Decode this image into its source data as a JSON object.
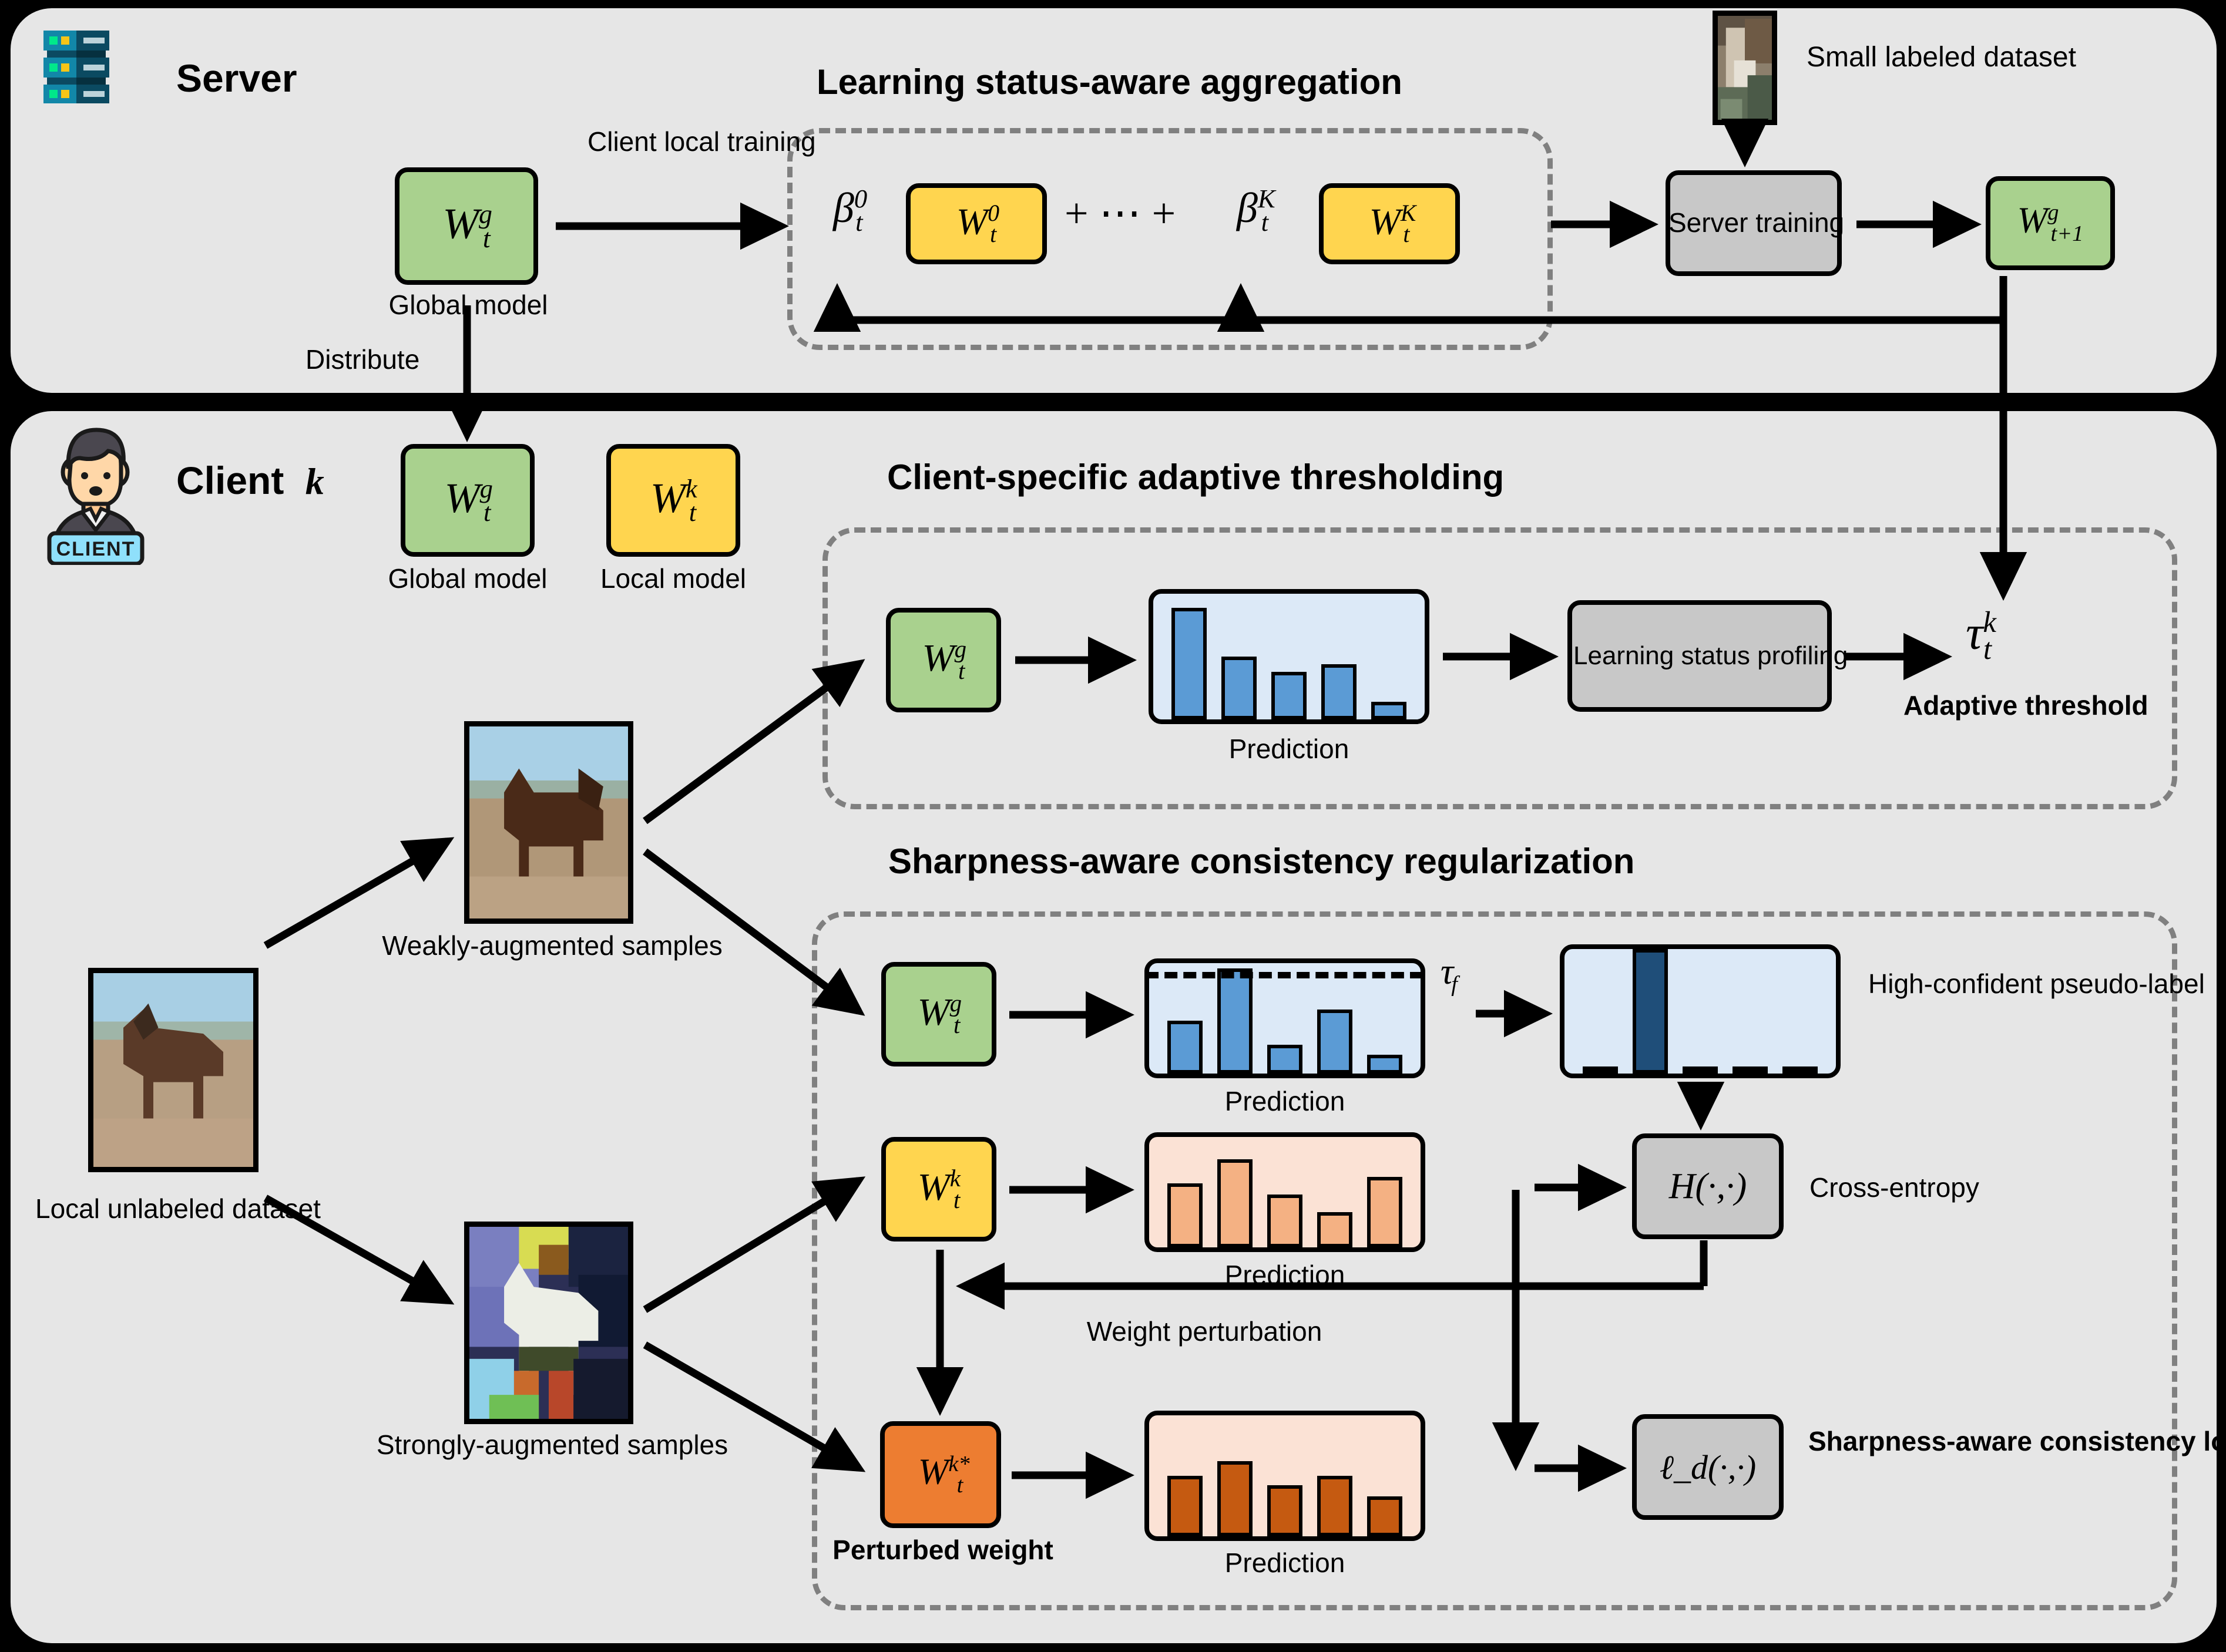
{
  "server": {
    "label": "Server",
    "icon": "server-rack-icon",
    "section_title": "Learning status-aware aggregation",
    "global_model_box": "W_t^g",
    "global_model_caption": "Global model",
    "arrow_label_client_local_training": "Client local training",
    "aggregation": {
      "beta_first": "β_t^0",
      "w_first": "W_t^0",
      "ellipsis": "+ ⋯ +",
      "beta_last": "β_t^K",
      "w_last": "W_t^K"
    },
    "small_labeled_dataset_label": "Small labeled dataset",
    "server_training_label": "Server training",
    "next_global_model": "W_{t+1}^g",
    "distribute_label": "Distribute"
  },
  "client": {
    "label": "Client",
    "index": "k",
    "icon": "client-person-icon",
    "icon_badge": "CLIENT",
    "global_model_box": "W_t^g",
    "global_model_caption": "Global model",
    "local_model_box": "W_t^k",
    "local_model_caption": "Local model",
    "local_dataset_caption": "Local unlabeled dataset",
    "weak_aug_caption": "Weakly-augmented samples",
    "strong_aug_caption": "Strongly-augmented samples"
  },
  "thresholding": {
    "section_title": "Client-specific adaptive thresholding",
    "model_box": "W_t^g",
    "prediction_caption": "Prediction",
    "profiling_label": "Learning status profiling",
    "tau_symbol": "τ_t^k",
    "tau_caption": "Adaptive threshold"
  },
  "sharpness": {
    "section_title": "Sharpness-aware consistency regularization",
    "global_box": "W_t^g",
    "local_box": "W_t^k",
    "perturbed_box": "W_t^{k*}",
    "perturbed_caption": "Perturbed weight",
    "prediction_caption": "Prediction",
    "tau_f": "τ_f",
    "pseudo_label_caption": "High-confident pseudo-label",
    "cross_entropy_symbol": "H(·,·)",
    "cross_entropy_caption": "Cross-entropy",
    "weight_perturbation_label": "Weight perturbation",
    "loss_symbol": "ℓ_d(·,·)",
    "loss_caption": "Sharpness-aware consistency loss"
  },
  "colors": {
    "panel_bg": "#e6e6e6",
    "green": "#a9d18e",
    "yellow": "#ffd54f",
    "orange": "#ed7d31",
    "grey_box": "#c8c8c8",
    "chart_blue_bg": "#dce9f7",
    "chart_peach_bg": "#fbe2d5",
    "bar_blue": "#5b9bd5",
    "bar_navy": "#1f4e79",
    "bar_light_orange": "#f4b183",
    "bar_dark_orange": "#c55a11",
    "dashed_border": "#808080",
    "outline": "#000000"
  },
  "chart_data": [
    {
      "id": "thresholding-prediction",
      "type": "bar",
      "title": "Prediction",
      "categories": [
        "1",
        "2",
        "3",
        "4",
        "5"
      ],
      "values": [
        0.9,
        0.5,
        0.38,
        0.44,
        0.14
      ],
      "ylim": [
        0,
        1
      ],
      "series_color": "#5b9bd5",
      "grid": false,
      "legend": "none"
    },
    {
      "id": "weak-aug-prediction",
      "type": "bar",
      "title": "Prediction",
      "categories": [
        "1",
        "2",
        "3",
        "4",
        "5"
      ],
      "values": [
        0.48,
        0.95,
        0.26,
        0.58,
        0.17
      ],
      "ylim": [
        0,
        1
      ],
      "threshold": 0.88,
      "threshold_label": "τ_f",
      "series_color": "#5b9bd5",
      "grid": false,
      "legend": "none"
    },
    {
      "id": "high-confident-pseudo-label",
      "type": "bar",
      "title": "High-confident pseudo-label",
      "categories": [
        "1",
        "2",
        "3",
        "4",
        "5"
      ],
      "values": [
        0.03,
        1.0,
        0.03,
        0.03,
        0.03
      ],
      "ylim": [
        0,
        1
      ],
      "series_color": "#1f4e79",
      "grid": false,
      "legend": "none"
    },
    {
      "id": "local-model-prediction",
      "type": "bar",
      "title": "Prediction",
      "categories": [
        "1",
        "2",
        "3",
        "4",
        "5"
      ],
      "values": [
        0.58,
        0.8,
        0.48,
        0.32,
        0.64
      ],
      "ylim": [
        0,
        1
      ],
      "series_color": "#f4b183",
      "grid": false,
      "legend": "none"
    },
    {
      "id": "perturbed-model-prediction",
      "type": "bar",
      "title": "Prediction",
      "categories": [
        "1",
        "2",
        "3",
        "4",
        "5"
      ],
      "values": [
        0.5,
        0.62,
        0.42,
        0.5,
        0.33
      ],
      "ylim": [
        0,
        1
      ],
      "series_color": "#c55a11",
      "grid": false,
      "legend": "none"
    }
  ]
}
